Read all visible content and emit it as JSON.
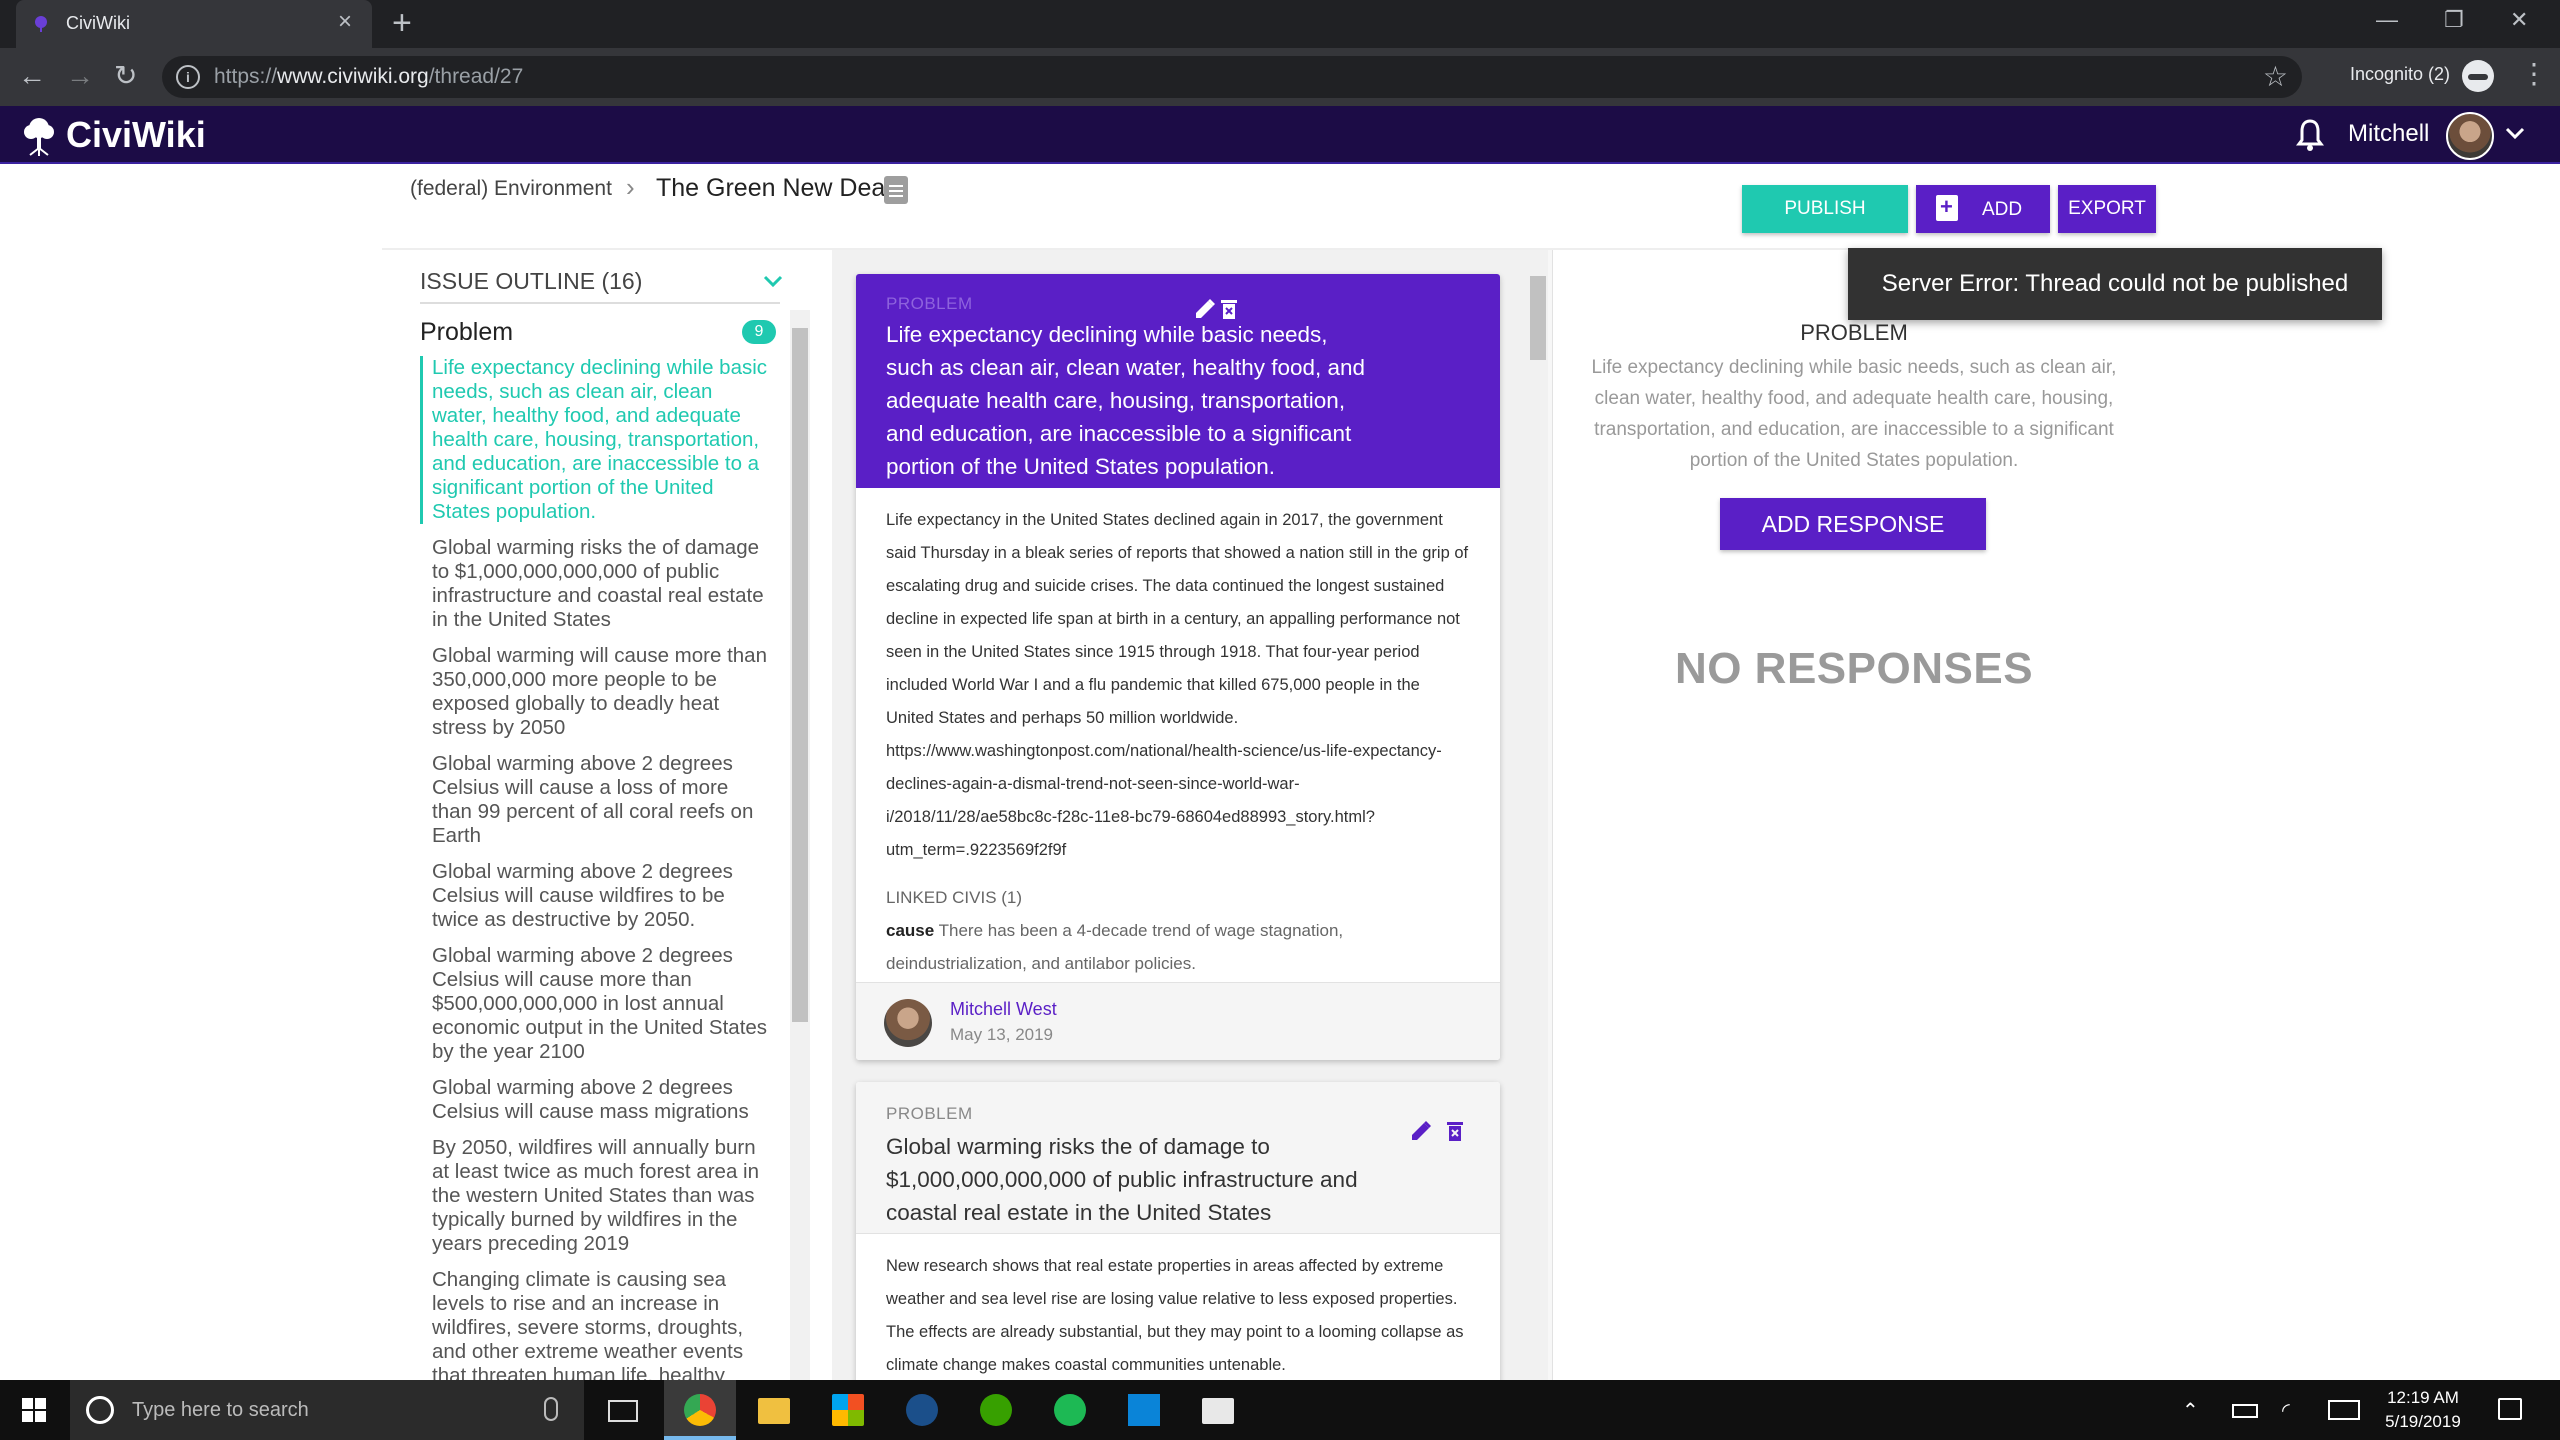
{
  "browser": {
    "tab_title": "CiviWiki",
    "url_prefix": "https://",
    "url_host": "www.civiwiki.org",
    "url_path": "/thread/27",
    "incognito": "Incognito (2)"
  },
  "header": {
    "logo": "CiviWiki",
    "user_name": "Mitchell"
  },
  "breadcrumb": {
    "category": "(federal) Environment",
    "separator": "›",
    "title": "The Green New Deal"
  },
  "actions": {
    "publish": "PUBLISH",
    "add": "ADD",
    "export": "EXPORT"
  },
  "toast": "Server Error: Thread could not be published",
  "outline": {
    "heading": "ISSUE OUTLINE (16)",
    "category": "Problem",
    "badge": "9",
    "items": [
      "Life expectancy declining while basic needs, such as clean air, clean water, healthy food, and adequate health care, housing, transportation, and education, are inaccessible to a significant portion of the United States population.",
      "Global warming risks the of damage to $1,000,000,000,000 of public infrastructure and coastal real estate in the United States",
      "Global warming will cause more than 350,000,000 more people to be exposed globally to deadly heat stress by 2050",
      "Global warming above 2 degrees Celsius will cause a loss of more than 99 percent of all coral reefs on Earth",
      "Global warming above 2 degrees Celsius will cause wildfires to be twice as destructive by 2050.",
      "Global warming above 2 degrees Celsius will cause more than $500,000,000,000 in lost annual economic output in the United States by the year 2100",
      "Global warming above 2 degrees Celsius will cause mass migrations",
      "By 2050, wildfires will annually burn at least twice as much forest area in the western United States than was typically burned by wildfires in the years preceding 2019",
      "Changing climate is causing sea levels to rise and an increase in wildfires, severe storms, droughts, and other extreme weather events that threaten human life, healthy communities, and critical"
    ]
  },
  "cards": [
    {
      "type": "PROBLEM",
      "title": "Life expectancy declining while basic needs, such as clean air, clean water, healthy food, and adequate health care, housing, transportation, and education, are inaccessible to a significant portion of the United States population.",
      "body": "Life expectancy in the United States declined again in 2017, the government said Thursday in a bleak series of reports that showed a nation still in the grip of escalating drug and suicide crises. The data continued the longest sustained decline in expected life span at birth in a century, an appalling performance not seen in the United States since 1915 through 1918. That four-year period included World War I and a flu pandemic that killed 675,000 people in the United States and perhaps 50 million worldwide. https://www.washingtonpost.com/national/health-science/us-life-expectancy-declines-again-a-dismal-trend-not-seen-since-world-war-i/2018/11/28/ae58bc8c-f28c-11e8-bc79-68604ed88993_story.html?utm_term=.9223569f2f9f",
      "linked_label": "LINKED CIVIS (1)",
      "linked_type": "cause",
      "linked_text": "There has been a 4-decade trend of wage stagnation, deindustrialization, and antilabor policies.",
      "author": "Mitchell West",
      "date": "May 13, 2019"
    },
    {
      "type": "PROBLEM",
      "title": "Global warming risks the of damage to $1,000,000,000,000 of public infrastructure and coastal real estate in the United States",
      "body": "New research shows that real estate properties in areas affected by extreme weather and sea level rise are losing value relative to less exposed properties. The effects are already substantial, but they may point to a looming collapse as climate change makes coastal communities untenable."
    }
  ],
  "response_panel": {
    "type": "PROBLEM",
    "text": "Life expectancy declining while basic needs, such as clean air, clean water, healthy food, and adequate health care, housing, transportation, and education, are inaccessible to a significant portion of the United States population.",
    "add_response": "ADD RESPONSE",
    "empty": "NO RESPONSES"
  },
  "taskbar": {
    "search_placeholder": "Type here to search",
    "time": "12:19 AM",
    "date": "5/19/2019"
  },
  "colors": {
    "brand_purple": "#5a1fc6",
    "teal": "#1fc9b0",
    "header_bg": "#1c0c46"
  }
}
